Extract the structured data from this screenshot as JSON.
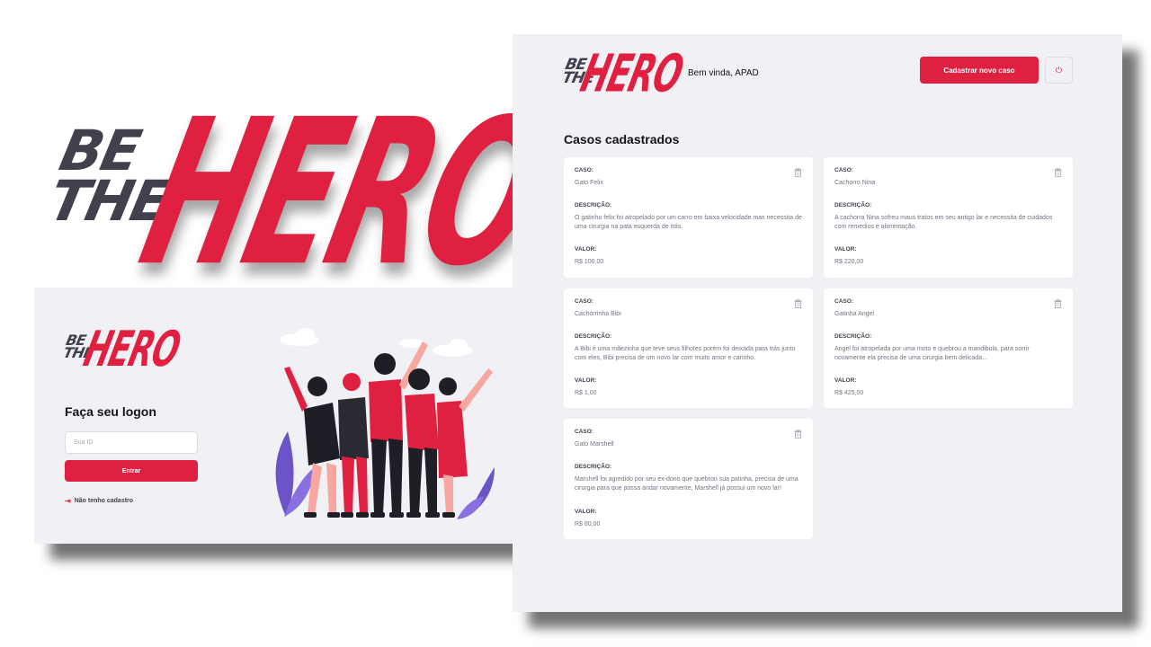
{
  "logo": {
    "be": "BE",
    "the": "THE",
    "hero": "HERO"
  },
  "login": {
    "title": "Faça seu logon",
    "id_placeholder": "Sua ID",
    "enter_label": "Entrar",
    "register_label": "Não tenho cadastro",
    "register_icon": "log-in-icon"
  },
  "dashboard": {
    "welcome": "Bem vinda, APAD",
    "new_case_label": "Cadastrar novo caso",
    "power_icon": "power-icon",
    "title": "Casos cadastrados",
    "labels": {
      "case": "CASO:",
      "description": "DESCRIÇÃO:",
      "value": "VALOR:"
    },
    "cases": [
      {
        "name": "Gato Felix",
        "description": "O gatinho felix foi atropelado por um carro em baixa velocidade mas necessita de uma cirurgia na pata esquerda de trás.",
        "value": "R$ 100,00"
      },
      {
        "name": "Cachorro Nina",
        "description": "A cachorra Nina sofreu maus tratos em seu antigo lar e necessita de cuidados com remedios e alimentação.",
        "value": "R$ 220,00"
      },
      {
        "name": "Cachorrinha Bibi",
        "description": "A Bibi é uma mãezinha que teve seus filhotes porém foi deixada para trás junto com eles, Bibi precisa de um novo lar com muito amor e carinho.",
        "value": "R$ 1,00"
      },
      {
        "name": "Gatinha Angel",
        "description": "Angel foi atropelada por uma moto e quebrou a mandibula, para sorrir novamente ela precisa de uma cirurgia bem delicada...",
        "value": "R$ 425,00"
      },
      {
        "name": "Gato Marshell",
        "description": "Marshell foi agredido por seu ex-dono que quebrou sua patinha, precisa de uma cirurgia para que possa andar novamente, Marshell já possui um novo lar!",
        "value": "R$ 80,00"
      }
    ]
  },
  "colors": {
    "brand_red": "#e02041",
    "dark": "#41414d",
    "background": "#f0f0f5"
  }
}
